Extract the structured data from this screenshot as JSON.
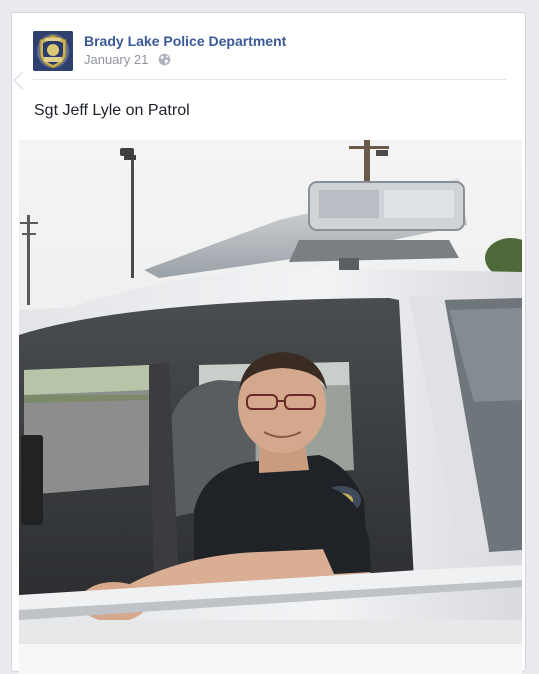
{
  "post": {
    "page_name": "Brady Lake Police Department",
    "date": "January 21",
    "audience_icon": "globe-icon",
    "text": "Sgt Jeff Lyle on Patrol",
    "avatar_icon": "police-badge-icon"
  },
  "colors": {
    "link": "#3b5998",
    "meta": "#90949c",
    "text": "#1d2129",
    "background": "#e9ebee"
  }
}
